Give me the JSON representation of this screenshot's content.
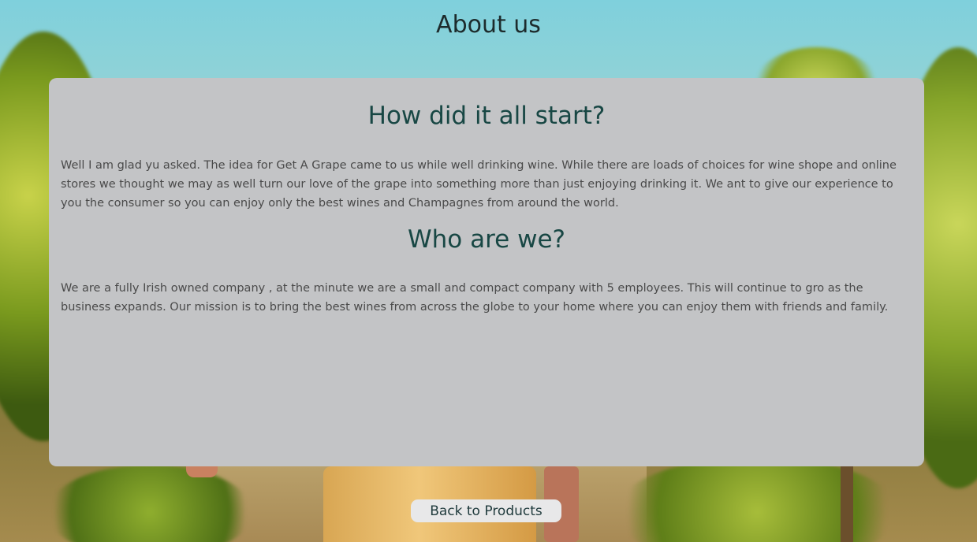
{
  "page": {
    "title": "About us"
  },
  "sections": [
    {
      "heading": "How did it all start?",
      "text": "Well I am glad yu asked. The idea for Get A Grape came to us while well drinking wine. While there are loads of choices for wine shope and online stores we thought we may as well turn our love of the grape into something more than just enjoying drinking it. We ant to give our experience to you the consumer so you can enjoy only the best wines and Champagnes from around the world."
    },
    {
      "heading": "Who are we?",
      "text": "We are a fully Irish owned company , at the minute we are a small and compact company with 5 employees. This will continue to gro as the business expands. Our mission is to bring the best wines from across the globe to your home where you can enjoy them with friends and family."
    }
  ],
  "footer": {
    "back_button_label": "Back to Products"
  },
  "colors": {
    "card_background": "#c3c4c6",
    "heading": "#184744",
    "body_text": "#4a4a4a",
    "button_background": "#e8e8e9"
  }
}
